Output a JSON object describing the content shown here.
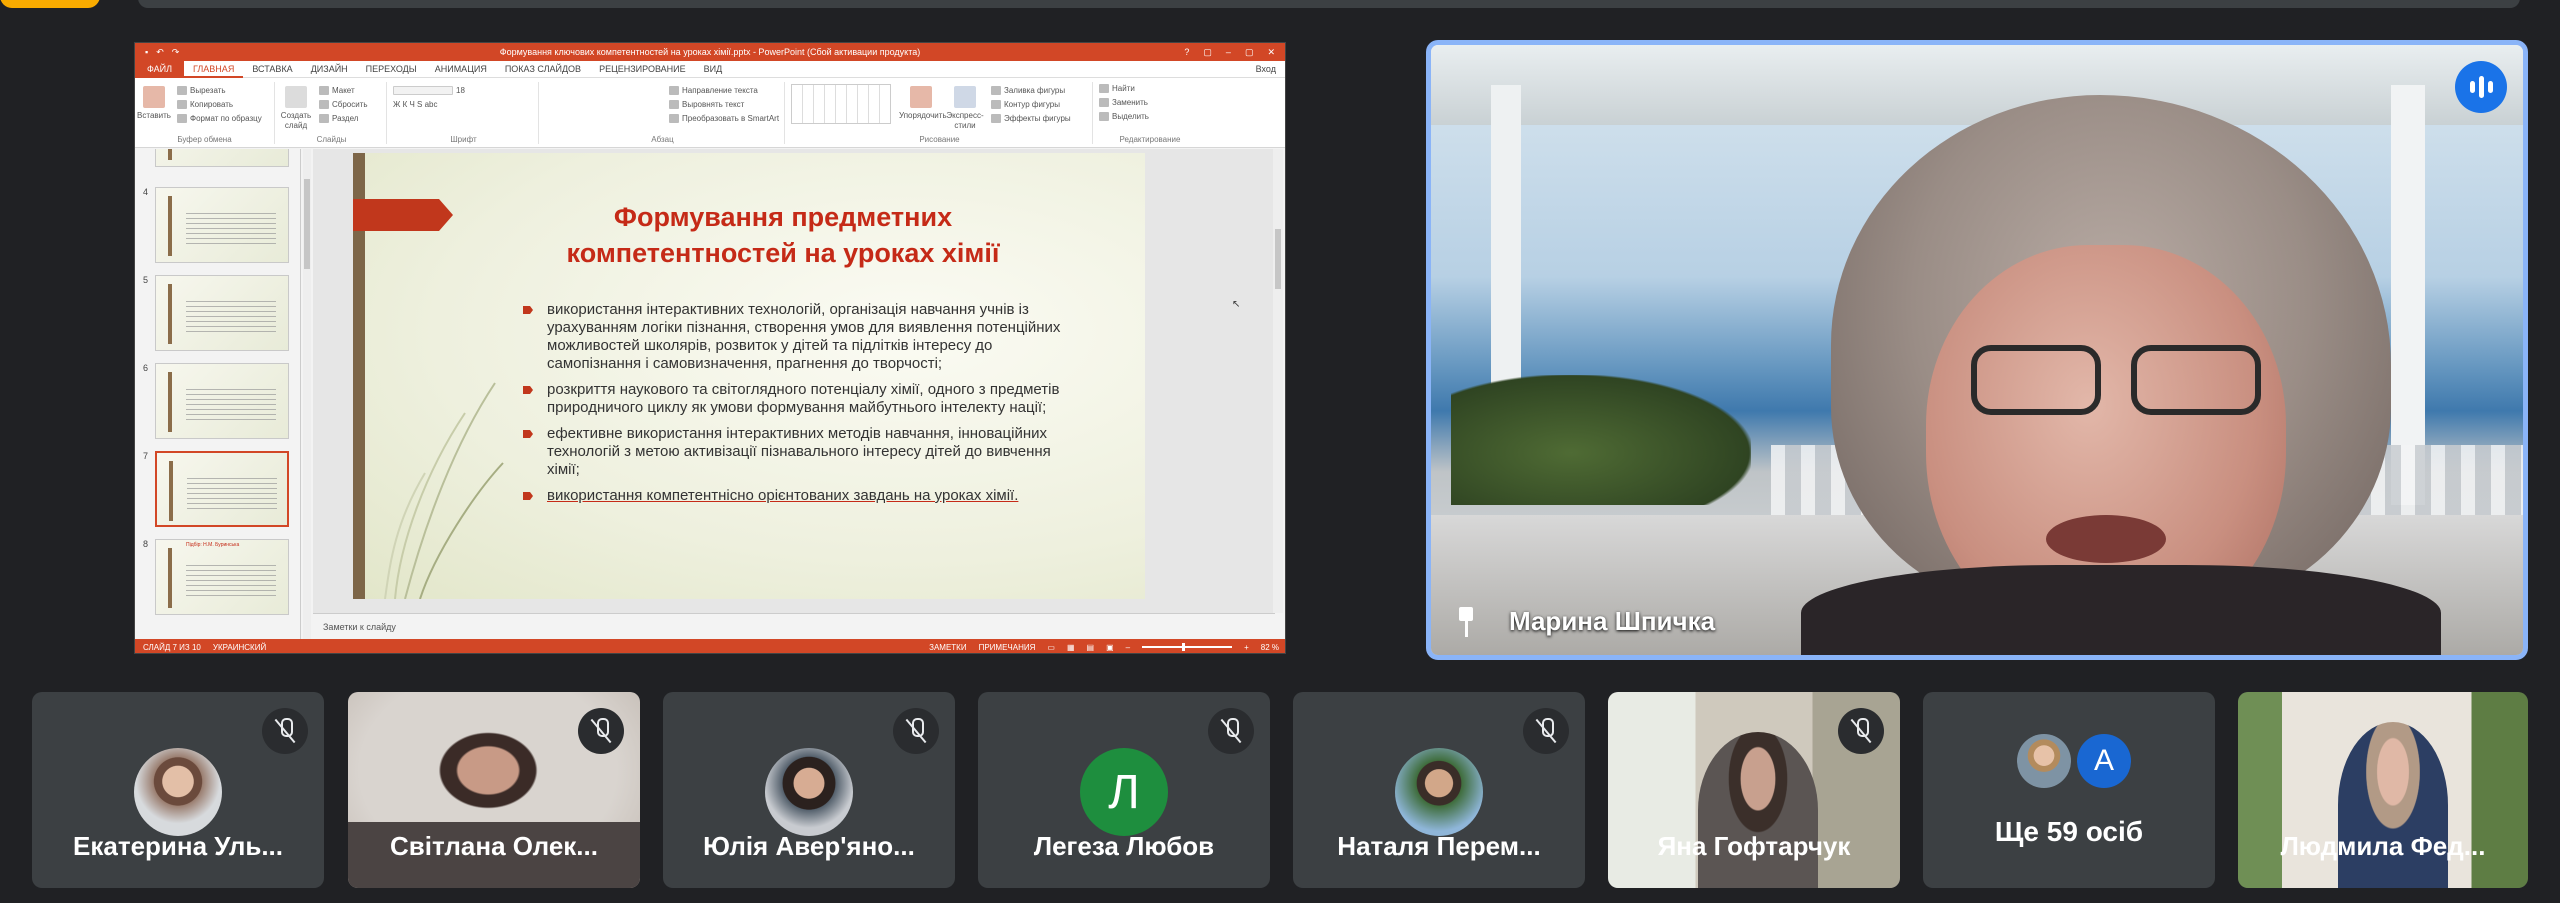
{
  "presentation": {
    "window_title": "Формування ключових компетентностей на уроках хімії.pptx - PowerPoint (Сбой активации продукта)",
    "window_controls": [
      "?",
      "▢",
      "–",
      "▢",
      "✕"
    ],
    "tabs": [
      "ФАЙЛ",
      "ГЛАВНАЯ",
      "ВСТАВКА",
      "ДИЗАЙН",
      "ПЕРЕХОДЫ",
      "АНИМАЦИЯ",
      "ПОКАЗ СЛАЙДОВ",
      "РЕЦЕНЗИРОВАНИЕ",
      "ВИД"
    ],
    "login": "Вход",
    "ribbon": {
      "paste": "Вставить",
      "cut": "Вырезать",
      "copy": "Копировать",
      "format_painter": "Формат по образцу",
      "clipboard_group": "Буфер обмена",
      "new_slide": "Создать слайд",
      "layout": "Макет",
      "reset": "Сбросить",
      "section": "Раздел",
      "slides_group": "Слайды",
      "font_group": "Шрифт",
      "text_direction": "Направление текста",
      "align_text": "Выровнять текст",
      "smartart": "Преобразовать в SmartArt",
      "paragraph_group": "Абзац",
      "arrange": "Упорядочить",
      "quick_styles": "Экспресс-стили",
      "shape_fill": "Заливка фигуры",
      "shape_outline": "Контур фигуры",
      "shape_effects": "Эффекты фигуры",
      "drawing_group": "Рисование",
      "find": "Найти",
      "replace": "Заменить",
      "select": "Выделить",
      "editing_group": "Редактирование",
      "font_size": "18"
    },
    "thumbnails": [
      "4",
      "5",
      "6",
      "7",
      "8"
    ],
    "thumb8_title": "Підбір: Н.М. Буринська",
    "slide": {
      "title_line1": "Формування предметних",
      "title_line2": "компетентностей на уроках хімії",
      "bullets": [
        "використання інтерактивних технологій, організація навчання учнів із урахуванням логіки пізнання, створення умов для виявлення потенційних можливостей школярів, розвиток у дітей та підлітків інтересу до самопізнання і самовизначення, прагнення до творчості;",
        "розкриття наукового та світоглядного потенціалу хімії, одного з предметів природничого циклу як умови формування майбутнього інтелекту нації;",
        "ефективне використання інтерактивних методів навчання, інноваційних технологій з метою активізації пізнавального інтересу дітей до вивчення хімії;",
        "використання компетентнісно орієнтованих завдань на уроках хімії."
      ]
    },
    "notes_placeholder": "Заметки к слайду",
    "status": {
      "slide_count": "СЛАЙД 7 ИЗ 10",
      "language": "УКРАИНСКИЙ",
      "notes": "ЗАМЕТКИ",
      "comments": "ПРИМЕЧАНИЯ",
      "zoom": "82 %"
    }
  },
  "speaker": {
    "name": "Марина Шпичка"
  },
  "participants": [
    {
      "name": "Екатерина Уль...",
      "type": "photo",
      "muted": true
    },
    {
      "name": "Світлана Олек...",
      "type": "video",
      "muted": true
    },
    {
      "name": "Юлія Авер'яно...",
      "type": "photo",
      "muted": true
    },
    {
      "name": "Легеза Любов",
      "type": "letter",
      "letter": "Л",
      "muted": true
    },
    {
      "name": "Наталя Перем...",
      "type": "photo",
      "muted": true
    },
    {
      "name": "Яна Гофтарчук",
      "type": "video",
      "muted": true
    },
    {
      "name": "Ще 59 осіб",
      "type": "more",
      "letter": "A"
    },
    {
      "name": "Людмила Фед...",
      "type": "video",
      "muted": false
    }
  ],
  "colors": {
    "ppt_accent": "#d24726",
    "slide_title": "#c52a17",
    "speaker_border": "#8ab4f8",
    "meet_bg": "#202124",
    "tile_bg": "#3c4043"
  }
}
